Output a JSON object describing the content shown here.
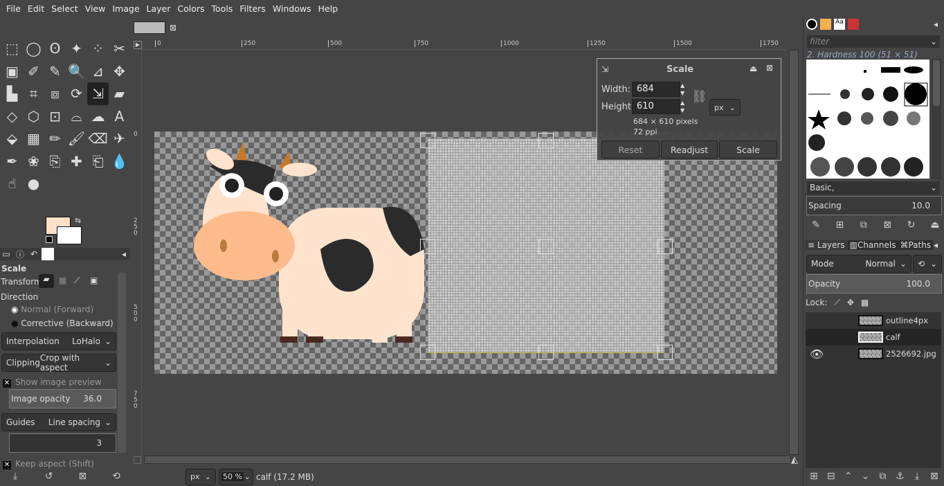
{
  "menu": [
    "File",
    "Edit",
    "Select",
    "View",
    "Image",
    "Layer",
    "Colors",
    "Tools",
    "Filters",
    "Windows",
    "Help"
  ],
  "toolbox": {
    "tools": [
      "rect-select",
      "ellipse-select",
      "free-select",
      "fuzzy-select",
      "select-by-color",
      "scissors",
      "foreground-select",
      "paths",
      "color-picker",
      "zoom",
      "measure",
      "move",
      "align",
      "crop",
      "unified-transform",
      "rotate",
      "scale",
      "shear",
      "perspective",
      "3d-transform",
      "handle-transform",
      "cage",
      "warp",
      "text",
      "bucket-fill",
      "gradient",
      "pencil",
      "paintbrush",
      "eraser",
      "airbrush",
      "ink",
      "mypaint",
      "clone",
      "heal",
      "perspective-clone",
      "blur",
      "smudge",
      "dodge-burn"
    ],
    "active_index": 16,
    "fg_color": "#ffe0c8",
    "bg_color": "#ffffff"
  },
  "tool_options": {
    "title": "Scale",
    "transform_label": "Transform:",
    "direction_label": "Direction",
    "direction_normal": "Normal (Forward)",
    "direction_corrective": "Corrective (Backward)",
    "interpolation_label": "Interpolation",
    "interpolation_value": "LoHalo",
    "clipping_label": "Clipping",
    "clipping_value": "Crop with aspect",
    "show_preview": "Show image preview",
    "image_opacity_label": "Image opacity",
    "image_opacity_value": "36.0",
    "guides_label": "Guides",
    "guides_value": "Line spacing",
    "guides_count": "3",
    "keep_aspect": "Keep aspect (Shift)"
  },
  "image_tab": {
    "close": "⊠"
  },
  "rulers": {
    "h": [
      "0",
      "250",
      "500",
      "750",
      "1000",
      "1250",
      "1500",
      "1750"
    ],
    "v": [
      "0",
      "250",
      "500",
      "750"
    ]
  },
  "scale_dialog": {
    "title": "Scale",
    "width_label": "Width:",
    "width_value": "684",
    "height_label": "Height:",
    "height_value": "610",
    "unit": "px",
    "size_info": "684 × 610 pixels",
    "ppi": "72 ppi",
    "reset": "Reset",
    "readjust": "Readjust",
    "scale": "Scale"
  },
  "status": {
    "unit": "px",
    "zoom": "50 %",
    "info": "calf (17.2 MB)"
  },
  "brushes": {
    "filter_placeholder": "filter",
    "selected": "2. Hardness 100 (51 × 51)",
    "preset": "Basic,",
    "spacing_label": "Spacing",
    "spacing_value": "10.0"
  },
  "layers": {
    "tabs": [
      "Layers",
      "Channels",
      "Paths"
    ],
    "mode_label": "Mode",
    "mode_value": "Normal",
    "opacity_label": "Opacity",
    "opacity_value": "100.0",
    "lock_label": "Lock:",
    "items": [
      {
        "name": "outline4px",
        "visible": false
      },
      {
        "name": "calf",
        "visible": false,
        "active": true
      },
      {
        "name": "2526692.jpg",
        "visible": true
      }
    ]
  }
}
